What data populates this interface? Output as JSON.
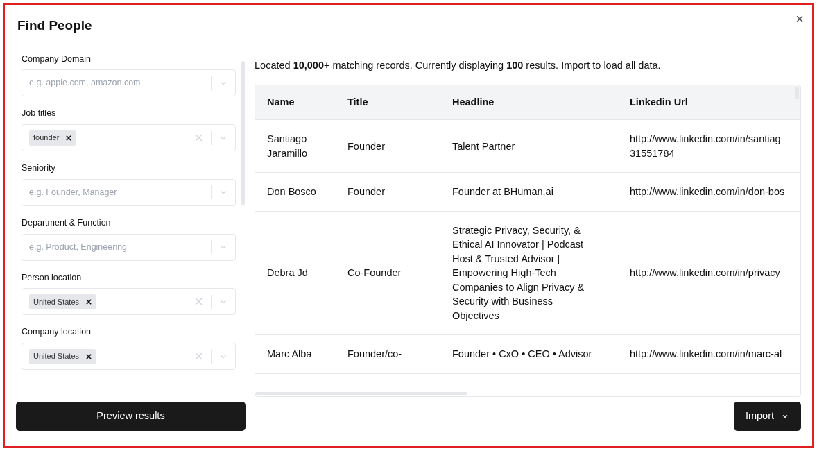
{
  "dialog": {
    "title": "Find People",
    "close": "×"
  },
  "filters": [
    {
      "label": "Company Domain",
      "placeholder": "e.g. apple.com, amazon.com"
    },
    {
      "label": "Job titles",
      "tags": [
        "founder"
      ]
    },
    {
      "label": "Seniority",
      "placeholder": "e.g. Founder, Manager"
    },
    {
      "label": "Department & Function",
      "placeholder": "e.g. Product, Engineering"
    },
    {
      "label": "Person location",
      "tags": [
        "United States"
      ]
    },
    {
      "label": "Company location",
      "tags": [
        "United States"
      ]
    }
  ],
  "summary": "Located **10,000+** matching records. Currently displaying **100** results. Import to load all data.",
  "table": {
    "columns": [
      "Name",
      "Title",
      "Headline",
      "Linkedin Url"
    ],
    "rows": [
      {
        "name": "Santiago Jaramillo",
        "title": "Founder",
        "headline": "Talent Partner",
        "url": [
          "http://www.linkedin.com/in/santiag",
          "31551784"
        ]
      },
      {
        "name": "Don Bosco",
        "title": "Founder",
        "headline": "Founder at BHuman.ai",
        "url": [
          "http://www.linkedin.com/in/don-bos"
        ]
      },
      {
        "name": "Debra Jd",
        "title": "Co-Founder",
        "headline": "Strategic Privacy, Security, & Ethical AI Innovator | Podcast Host & Trusted Advisor | Empowering High-Tech Companies to Align Privacy & Security with Business Objectives",
        "url": [
          "http://www.linkedin.com/in/privacy"
        ]
      },
      {
        "name": "Marc Alba",
        "title": "Founder/co-",
        "headline": "Founder • CxO • CEO • Advisor",
        "url": [
          "http://www.linkedin.com/in/marc-al"
        ]
      }
    ]
  },
  "buttons": {
    "preview": "Preview results",
    "import": "Import"
  }
}
